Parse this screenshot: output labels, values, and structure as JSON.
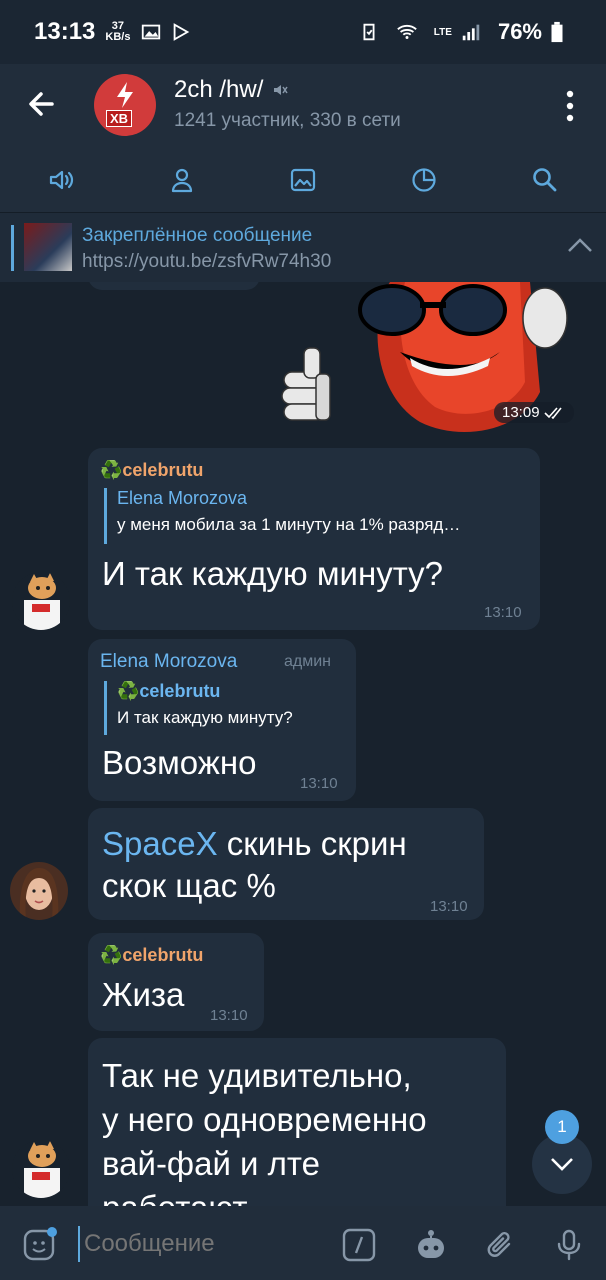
{
  "status_bar": {
    "time": "13:13",
    "net_speed_value": "37",
    "net_speed_unit": "KB/s",
    "network": "LTE",
    "battery": "76%"
  },
  "header": {
    "chat_title": "2ch /hw/",
    "subtitle": "1241 участник, 330 в сети",
    "avatar_label": "XB",
    "toolbar_icons": [
      "speaker-icon",
      "profile-icon",
      "image-icon",
      "pie-chart-icon",
      "search-icon"
    ]
  },
  "pinned": {
    "title": "Закреплённое сообщение",
    "text": "https://youtu.be/zsfvRw74h30"
  },
  "messages": [
    {
      "type": "sticker",
      "time": "13:09"
    },
    {
      "sender": "♻️celebrutu",
      "quote_name": "Elena Morozova",
      "quote_text": "у меня мобила за 1 минуту на 1% разряд…",
      "text": "И так каждую минуту?",
      "time": "13:10"
    },
    {
      "sender": "Elena Morozova",
      "role": "админ",
      "quote_name": "♻️celebrutu",
      "quote_text": "И так каждую минуту?",
      "text": "Возможно",
      "time": "13:10"
    },
    {
      "mention": "SpaceX",
      "text_line1": " скинь скрин",
      "text_line2": "скок щас %",
      "time": "13:10"
    },
    {
      "sender": "♻️celebrutu",
      "text": "Жиза",
      "time": "13:10"
    },
    {
      "line1": "Так не удивительно,",
      "line2": "у него одновременно",
      "line3": "вай-фай и лте",
      "line4": "работают"
    }
  ],
  "unread_count": "1",
  "input": {
    "placeholder": "Сообщение"
  }
}
